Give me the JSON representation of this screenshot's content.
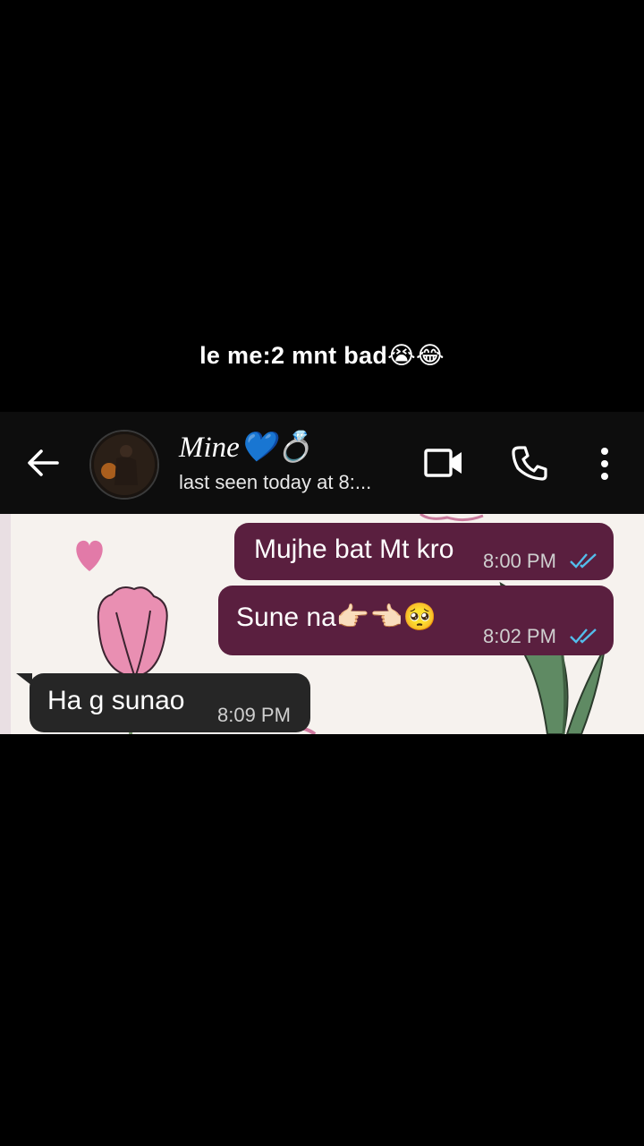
{
  "caption": "le me:2 mnt bad😭😂",
  "header": {
    "contact_name": "Mine💙💍",
    "last_seen": "last seen today at 8:..."
  },
  "messages": [
    {
      "direction": "outgoing",
      "text": "Mujhe bat Mt kro",
      "time": "8:00 PM",
      "status": "read"
    },
    {
      "direction": "outgoing",
      "text": "Sune na👉🏻👈🏻🥺",
      "time": "8:02 PM",
      "status": "read"
    },
    {
      "direction": "incoming",
      "text": "Ha g sunao",
      "time": "8:09 PM"
    }
  ],
  "colors": {
    "header_bg": "#0d0d0d",
    "outgoing_bubble": "#5a1f3f",
    "incoming_bubble": "#262626",
    "read_ticks": "#53bdeb",
    "wallpaper_bg": "#f6f2ee"
  },
  "icons": [
    "back-arrow-icon",
    "video-call-icon",
    "voice-call-icon",
    "more-options-icon",
    "double-check-icon",
    "heart-icon",
    "tulip-icon"
  ]
}
